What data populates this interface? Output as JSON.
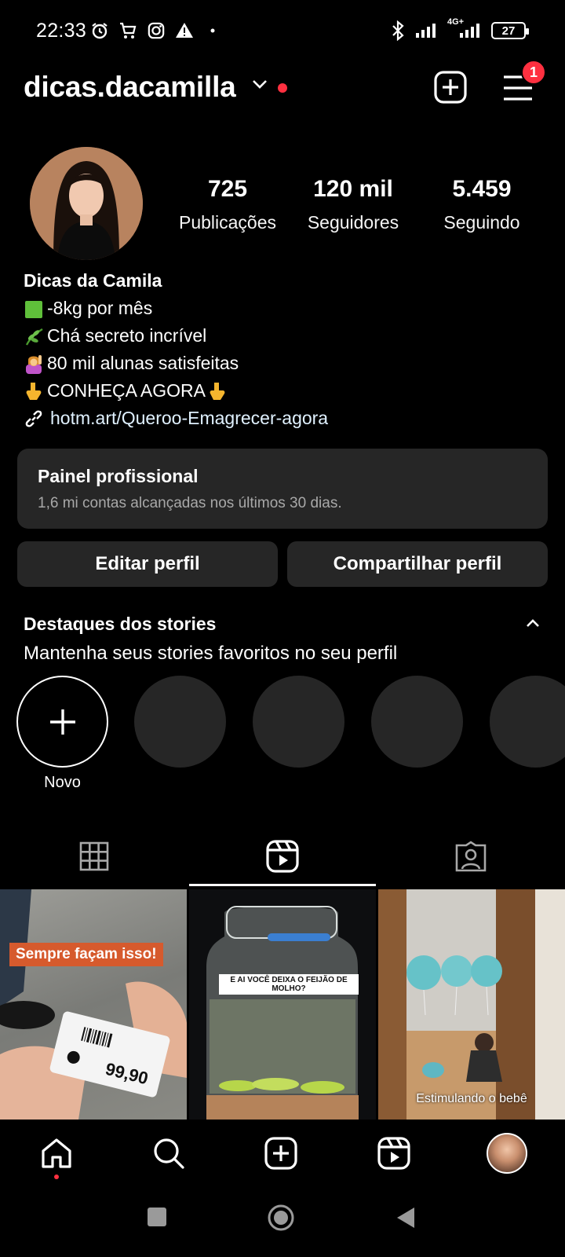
{
  "status_bar": {
    "time": "22:33",
    "network_label": "4G+",
    "battery": "27"
  },
  "header": {
    "username": "dicas.dacamilla",
    "notification_count": "1"
  },
  "profile": {
    "stats": [
      {
        "value": "725",
        "label": "Publicações"
      },
      {
        "value": "120 mil",
        "label": "Seguidores"
      },
      {
        "value": "5.459",
        "label": "Seguindo"
      }
    ],
    "name": "Dicas da Camila",
    "bio_lines": [
      {
        "icon": "green-square-icon",
        "text": "-8kg por mês"
      },
      {
        "icon": "herb-icon",
        "text": "Chá secreto incrível"
      },
      {
        "icon": "woman-raising-hand-icon",
        "text": "80 mil alunas satisfeitas"
      },
      {
        "icon": "pointing-down-icon",
        "text": "CONHEÇA AGORA"
      }
    ],
    "link": "hotm.art/Queroo-Emagrecer-agora"
  },
  "pro_dashboard": {
    "title": "Painel profissional",
    "subtitle": "1,6 mi contas alcançadas nos últimos 30 dias."
  },
  "buttons": {
    "edit_profile": "Editar perfil",
    "share_profile": "Compartilhar perfil"
  },
  "highlights": {
    "title": "Destaques dos stories",
    "subtitle": "Mantenha seus stories favoritos no seu perfil",
    "new_label": "Novo"
  },
  "tabs": [
    {
      "icon": "grid-icon"
    },
    {
      "icon": "reels-icon",
      "active": true
    },
    {
      "icon": "tagged-icon"
    }
  ],
  "posts": [
    {
      "overlay": "Sempre façam isso!",
      "price": "99,90"
    },
    {
      "overlay": "E AI VOCÊ DEIXA O FEIJÃO DE MOLHO?"
    },
    {
      "overlay": "Estimulando o bebê"
    }
  ],
  "colors": {
    "accent_red": "#ff3040",
    "surface": "#262626",
    "background": "#000000"
  }
}
